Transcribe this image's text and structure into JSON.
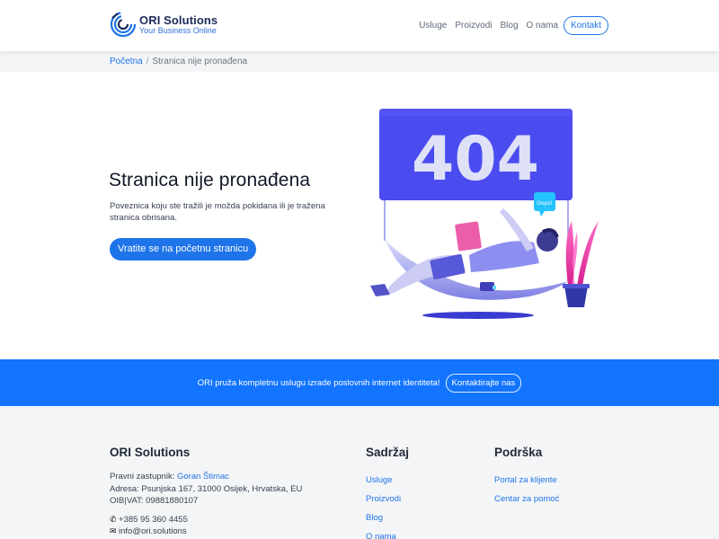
{
  "brand": {
    "name": "ORI Solutions",
    "tagline": "Your Business Online",
    "color": "#1e74e8"
  },
  "nav": {
    "items": [
      "Usluge",
      "Proizvodi",
      "Blog",
      "O nama"
    ],
    "contact_label": "Kontakt"
  },
  "breadcrumb": {
    "home": "Početna",
    "separator": "/",
    "current": "Stranica nije pronađena"
  },
  "main": {
    "title": "Stranica nije pronađena",
    "description": "Poveznica koju ste tražili je možda pokidana ili je tražena stranica obrisana.",
    "button_label": "Vratite se na početnu stranicu"
  },
  "illustration": {
    "code": "404",
    "bubble": "Oops!"
  },
  "cta": {
    "text": "ORI pruža kompletnu uslugu izrade poslovnih internet identiteta!",
    "button_label": "Kontaktirajte nas",
    "color": "#1274ff"
  },
  "footer": {
    "company": {
      "title": "ORI Solutions",
      "rep_label": "Pravni zastupnik:",
      "rep_name": "Goran Štimac",
      "address": "Adresa: Psunjska 167, 31000 Osijek, Hrvatska, EU",
      "oib": "OIB|VAT: 09881880107",
      "phone": "+385 95 360 4455",
      "email": "info@ori.solutions"
    },
    "content": {
      "title": "Sadržaj",
      "links": [
        "Usluge",
        "Proizvodi",
        "Blog",
        "O nama"
      ]
    },
    "support": {
      "title": "Podrška",
      "links": [
        "Portal za klijente",
        "Centar za pomoć"
      ]
    }
  }
}
